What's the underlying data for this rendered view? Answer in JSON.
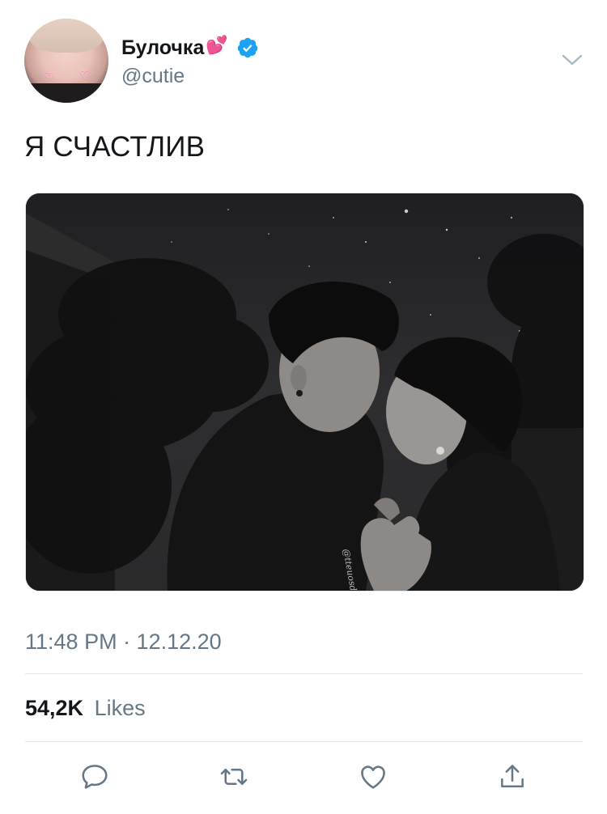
{
  "author": {
    "display_name": "Булочка",
    "name_emoji": "💕",
    "handle": "@cutie",
    "verified": true,
    "avatar_hearts": [
      "♡",
      "♡"
    ]
  },
  "tweet": {
    "text": "Я СЧАСТЛИВ",
    "timestamp": "11:48 PM · 12.12.20",
    "media_watermark": "@tteuosdruu"
  },
  "stats": {
    "likes_count": "54,2K",
    "likes_label": "Likes"
  },
  "actions": [
    "reply-icon",
    "retweet-icon",
    "like-icon",
    "share-icon"
  ],
  "colors": {
    "text_primary": "#14171a",
    "text_secondary": "#657786",
    "verified_blue": "#1da1f2",
    "divider": "#e1e8ed"
  }
}
